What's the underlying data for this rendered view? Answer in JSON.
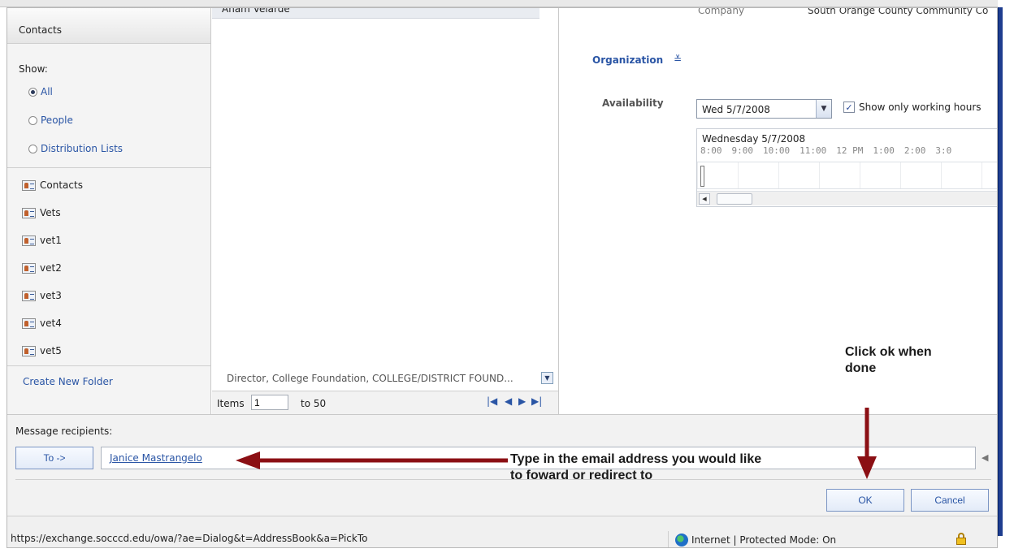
{
  "nav": {
    "header": "Contacts",
    "show_label": "Show:",
    "filters": [
      "All",
      "People",
      "Distribution Lists"
    ],
    "selected_filter": "All",
    "folders": [
      "Contacts",
      "Vets",
      "vet1",
      "vet2",
      "vet3",
      "vet4",
      "vet5"
    ],
    "create_folder": "Create New Folder"
  },
  "list": {
    "top_item": "Anam Velarde",
    "bottom_item": "Director, College Foundation, COLLEGE/DISTRICT FOUND...",
    "items_label": "Items",
    "items_value": "1",
    "to_label": "to 50"
  },
  "details": {
    "company_label": "Company",
    "company_value": "South Orange County Community Co",
    "organization_label": "Organization",
    "availability_label": "Availability",
    "date_value": "Wed 5/7/2008",
    "working_hours_label": "Show only working hours",
    "working_hours_checked": true,
    "timeline_date": "Wednesday 5/7/2008",
    "hours": [
      "8:00",
      "9:00",
      "10:00",
      "11:00",
      "12 PM",
      "1:00",
      "2:00",
      "3:0"
    ]
  },
  "recipients": {
    "label": "Message recipients:",
    "to_button": "To ->",
    "to_value": "Janice Mastrangelo"
  },
  "buttons": {
    "ok": "OK",
    "cancel": "Cancel"
  },
  "status": {
    "url": "https://exchange.socccd.edu/owa/?ae=Dialog&t=AddressBook&a=PickTo",
    "zone": "Internet | Protected Mode: On"
  },
  "annotations": {
    "ok_note_line1": "Click ok when",
    "ok_note_line2": "done",
    "type_note_line1": "Type in the email address you would like",
    "type_note_line2": "to foward or redirect to"
  },
  "colors": {
    "link": "#2a55a5",
    "arrow": "#8b0f14",
    "window_edge": "#1e3d8f"
  }
}
